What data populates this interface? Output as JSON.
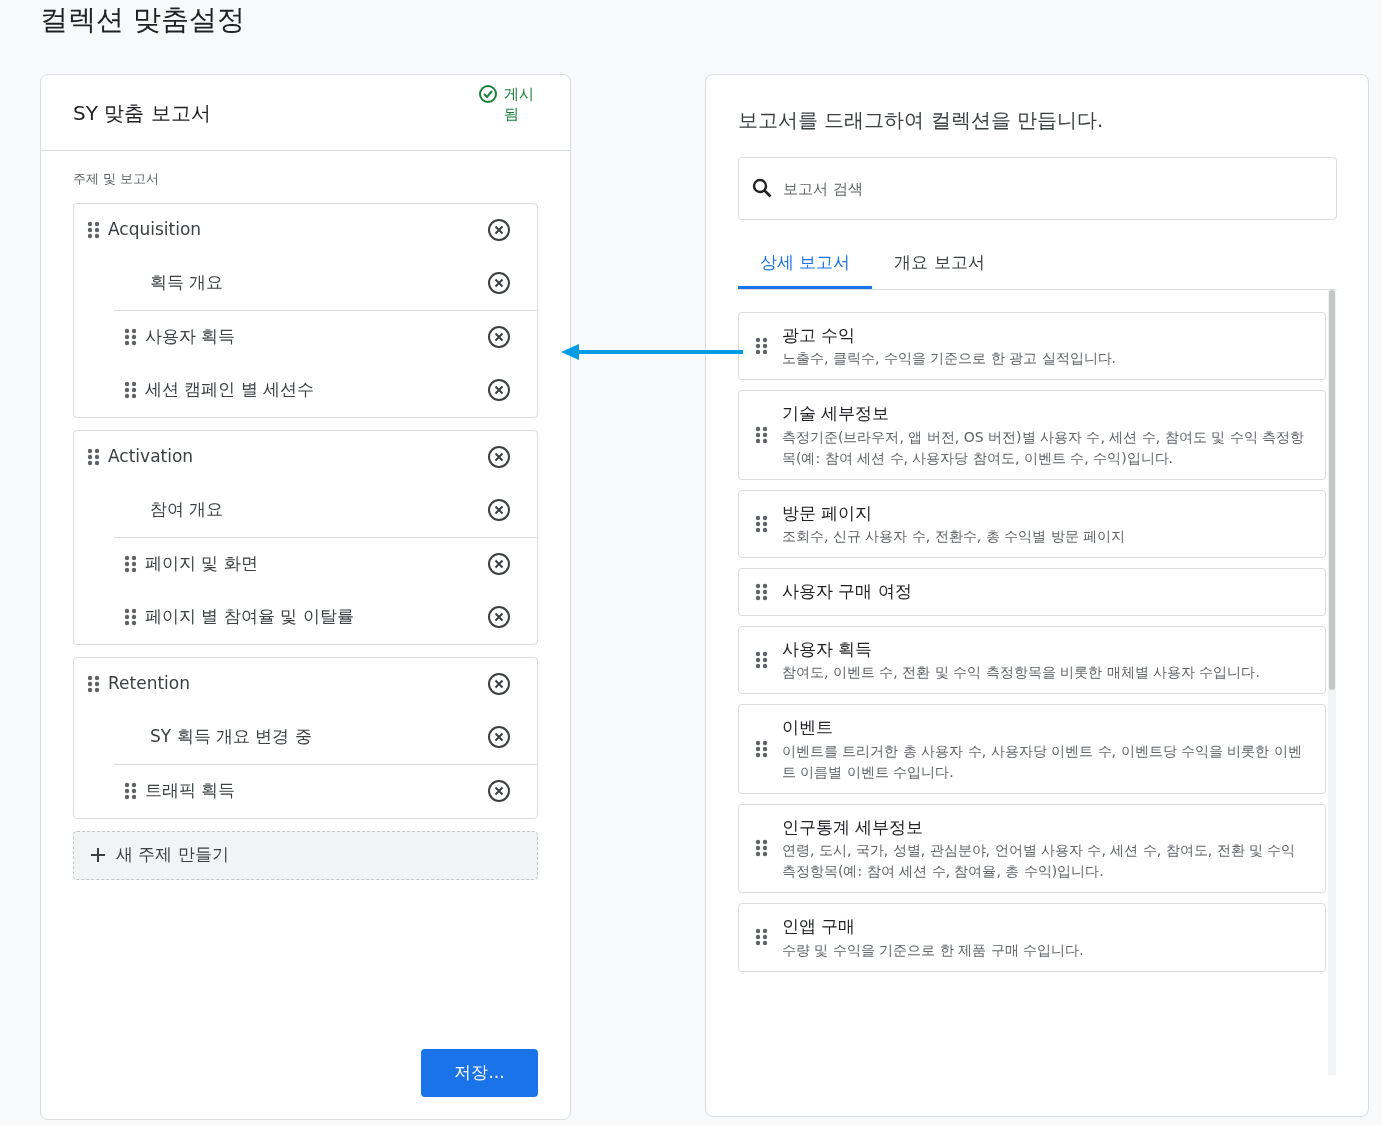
{
  "page_title": "컬렉션 맞춤설정",
  "collection": {
    "title": "SY 맞춤 보고서",
    "status": "게시됨",
    "published": true,
    "section_label": "주제 및 보고서",
    "topics": [
      {
        "name": "Acquisition",
        "items": [
          {
            "label": "획득 개요",
            "kind": "overview"
          },
          {
            "label": "사용자 획득",
            "kind": "report"
          },
          {
            "label": "세션 캠페인 별 세션수",
            "kind": "report"
          }
        ]
      },
      {
        "name": "Activation",
        "items": [
          {
            "label": "참여 개요",
            "kind": "overview"
          },
          {
            "label": "페이지 및 화면",
            "kind": "report"
          },
          {
            "label": "페이지 별 참여율 및 이탈률",
            "kind": "report"
          }
        ]
      },
      {
        "name": "Retention",
        "items": [
          {
            "label": "SY 획득 개요 변경 중",
            "kind": "overview"
          },
          {
            "label": "트래픽 획득",
            "kind": "report"
          }
        ]
      }
    ],
    "new_topic": "새 주제 만들기",
    "save_button": "저장..."
  },
  "library": {
    "instruction": "보고서를 드래그하여 컬렉션을 만듭니다.",
    "search": {
      "placeholder": "보고서 검색"
    },
    "tabs": [
      {
        "label": "상세 보고서",
        "selected": true
      },
      {
        "label": "개요 보고서",
        "selected": false
      }
    ],
    "reports": [
      {
        "title": "광고 수익",
        "description": "노출수, 클릭수, 수익을 기준으로 한 광고 실적입니다."
      },
      {
        "title": "기술 세부정보",
        "description": "측정기준(브라우저, 앱 버전, OS 버전)별 사용자 수, 세션 수, 참여도 및 수익 측정항목(예: 참여 세션 수, 사용자당 참여도, 이벤트 수, 수익)입니다."
      },
      {
        "title": "방문 페이지",
        "description": "조회수, 신규 사용자 수, 전환수, 총 수익별 방문 페이지"
      },
      {
        "title": "사용자 구매 여정"
      },
      {
        "title": "사용자 획득",
        "description": "참여도, 이벤트 수, 전환 및 수익 측정항목을 비롯한 매체별 사용자 수입니다."
      },
      {
        "title": "이벤트",
        "description": "이벤트를 트리거한 총 사용자 수, 사용자당 이벤트 수, 이벤트당 수익을 비롯한 이벤트 이름별 이벤트 수입니다."
      },
      {
        "title": "인구통계 세부정보",
        "description": "연령, 도시, 국가, 성별, 관심분야, 언어별 사용자 수, 세션 수, 참여도, 전환 및 수익 측정항목(예: 참여 세션 수, 참여율, 총 수익)입니다."
      },
      {
        "title": "인앱 구매",
        "description": "수량 및 수익을 기준으로 한 제품 구매 수입니다."
      }
    ]
  }
}
